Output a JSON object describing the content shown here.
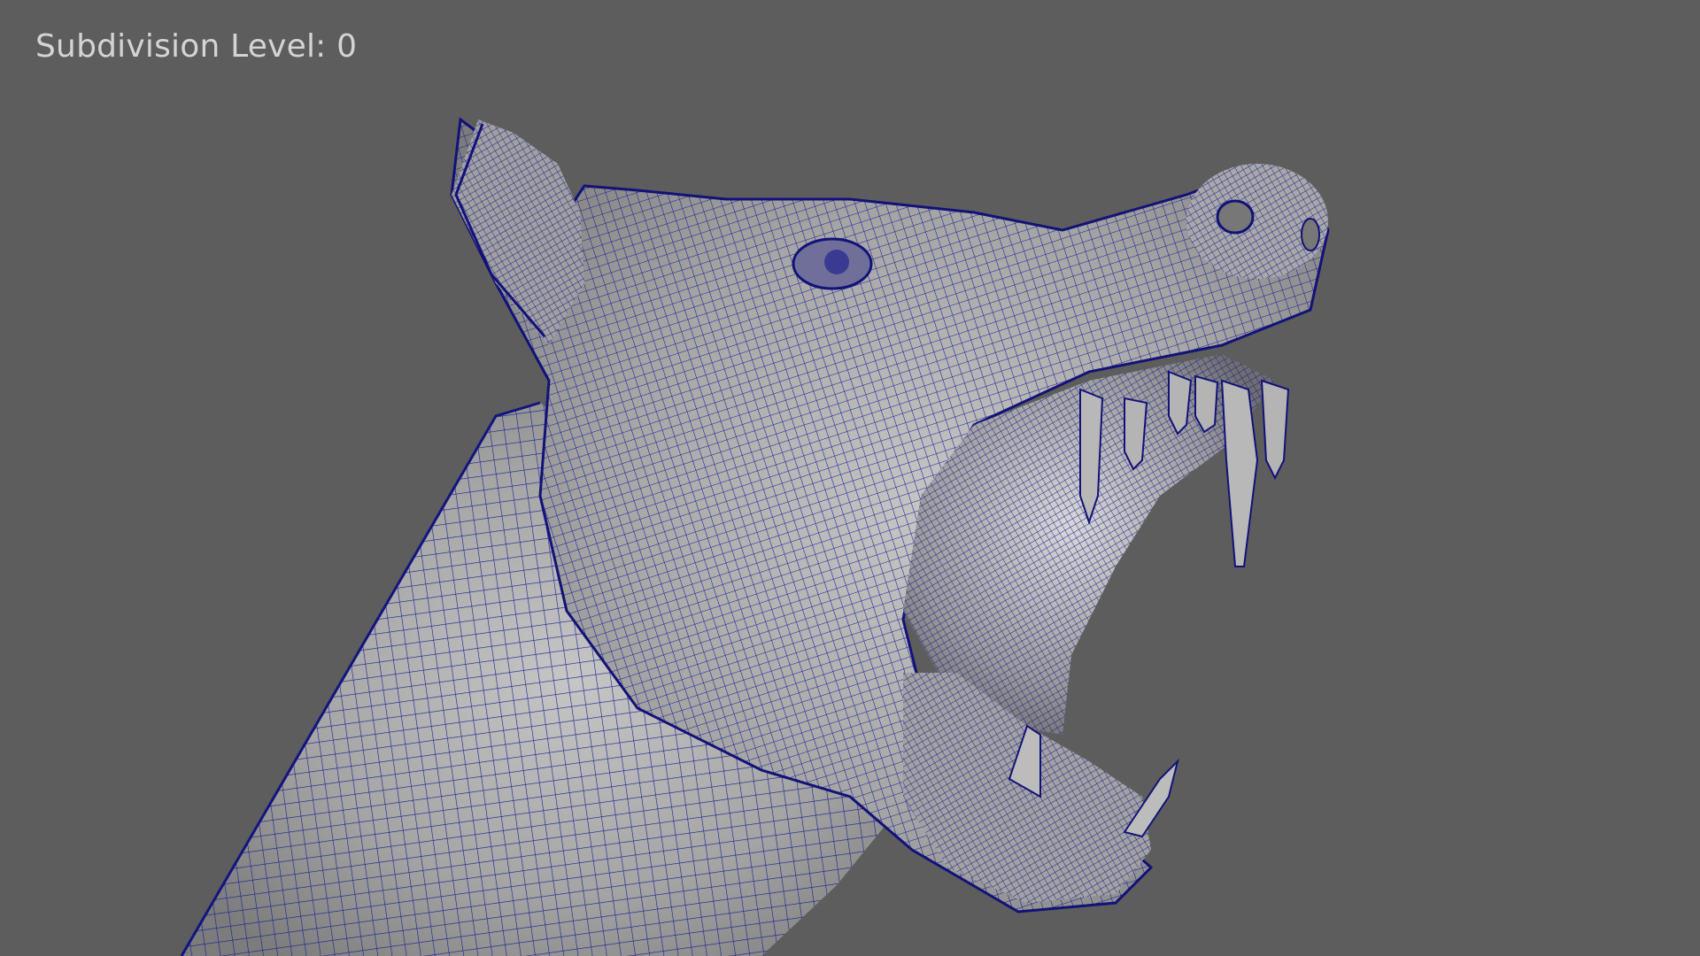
{
  "viewport": {
    "hud": {
      "subdivision_label": "Subdivision Level: 0"
    },
    "model": {
      "subject": "dog-head-wireframe-icon",
      "wire_color": "#1a1a8c",
      "surface_color": "#a9a9a9",
      "background_color": "#5d5d5d"
    }
  }
}
